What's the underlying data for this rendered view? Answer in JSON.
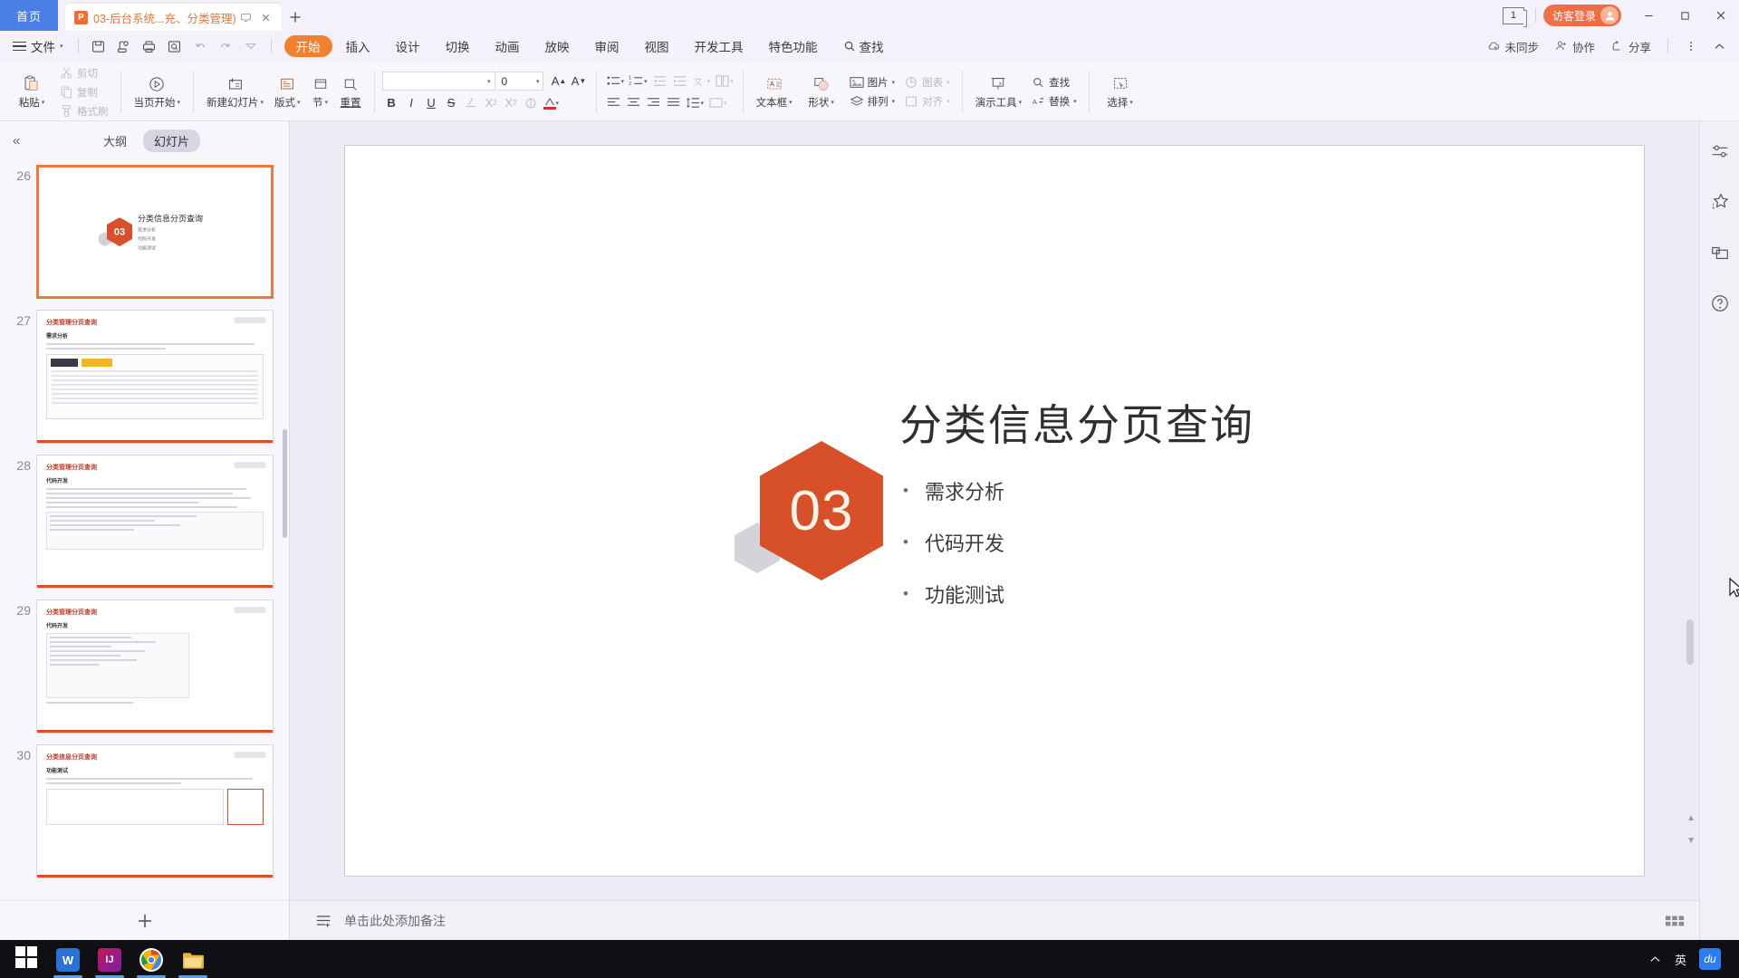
{
  "titlebar": {
    "home_tab": "首页",
    "document_tab": "03-后台系统...充、分类管理)",
    "doc_icon": "powerpoint-icon",
    "restore_tab_icon": "restore-tab-icon",
    "close_tab_icon": "close-tab-icon",
    "new_tab_icon": "new-tab-icon",
    "page_badge": "1",
    "guest_login": "访客登录",
    "avatar_icon": "user-avatar-icon",
    "minimize_icon": "minimize-icon",
    "maximize_icon": "maximize-icon",
    "close_icon": "close-icon"
  },
  "menubar": {
    "file_label": "文件",
    "quick_access": [
      {
        "name": "save-icon",
        "dim": false
      },
      {
        "name": "save-as-cloud-icon",
        "dim": false
      },
      {
        "name": "print-icon",
        "dim": false
      },
      {
        "name": "print-preview-icon",
        "dim": false
      },
      {
        "name": "undo-icon",
        "dim": true
      },
      {
        "name": "redo-icon",
        "dim": true
      },
      {
        "name": "customize-quick-access-icon",
        "dim": false
      }
    ],
    "tabs": [
      {
        "label": "开始",
        "active": true
      },
      {
        "label": "插入",
        "active": false
      },
      {
        "label": "设计",
        "active": false
      },
      {
        "label": "切换",
        "active": false
      },
      {
        "label": "动画",
        "active": false
      },
      {
        "label": "放映",
        "active": false
      },
      {
        "label": "审阅",
        "active": false
      },
      {
        "label": "视图",
        "active": false
      },
      {
        "label": "开发工具",
        "active": false
      },
      {
        "label": "特色功能",
        "active": false
      }
    ],
    "find_tab": "查找",
    "right_items": [
      {
        "label": "未同步",
        "icon": "cloud-sync-icon"
      },
      {
        "label": "协作",
        "icon": "collaborate-icon"
      },
      {
        "label": "分享",
        "icon": "share-icon"
      }
    ],
    "more_icon": "more-options-icon",
    "collapse_ribbon_icon": "collapse-ribbon-icon"
  },
  "toolbar": {
    "paste": "粘贴",
    "cut": "剪切",
    "copy": "复制",
    "format_painter": "格式刷",
    "start_from_page": "当页开始",
    "new_slide": "新建幻灯片",
    "layout": "版式",
    "section": "节",
    "reset": "重置",
    "font_name": "",
    "font_size": "0",
    "bold": "B",
    "italic": "I",
    "underline": "U",
    "strikethrough": "S",
    "text_color_icon": "text-color-icon",
    "clear_format_icon": "clear-format-icon",
    "superscript_icon": "superscript-icon",
    "subscript_icon": "subscript-icon",
    "char_shading_icon": "character-shading-icon",
    "increase_font_icon": "increase-font-size-icon",
    "decrease_font_icon": "decrease-font-size-icon",
    "align_left_icon": "align-left-icon",
    "align_center_icon": "align-center-icon",
    "align_right_icon": "align-right-icon",
    "align_justify_icon": "align-justify-icon",
    "bullet_list_icon": "bullet-list-icon",
    "number_list_icon": "numbered-list-icon",
    "decrease_indent_icon": "decrease-indent-icon",
    "increase_indent_icon": "increase-indent-icon",
    "line_spacing_icon": "line-spacing-icon",
    "columns_icon": "columns-icon",
    "text_direction_icon": "text-direction-icon",
    "textbox": "文本框",
    "shape": "形状",
    "picture": "图片",
    "chart": "图表",
    "arrange": "排列",
    "align_objects": "对齐",
    "present_tools": "演示工具",
    "find": "查找",
    "replace": "替换",
    "select": "选择"
  },
  "slide_panel": {
    "collapse_icon": "collapse-panel-icon",
    "tabs": [
      {
        "label": "大纲",
        "active": false
      },
      {
        "label": "幻灯片",
        "active": true
      }
    ],
    "add_slide_icon": "add-slide-icon",
    "thumbs": [
      {
        "number": "26",
        "selected": true,
        "type": "title",
        "hex_number": "03",
        "title": "分类信息分页查询",
        "bullets": [
          "需求分析",
          "代码开发",
          "功能测试"
        ]
      },
      {
        "number": "27",
        "selected": false,
        "type": "doc-table",
        "title": "分类管理分页查询",
        "subtitle": "需求分析"
      },
      {
        "number": "28",
        "selected": false,
        "type": "doc-code",
        "title": "分类管理分页查询",
        "subtitle": "代码开发"
      },
      {
        "number": "29",
        "selected": false,
        "type": "code-only",
        "title": "分类管理分页查询",
        "subtitle": "代码开发"
      },
      {
        "number": "30",
        "selected": false,
        "type": "doc-test",
        "title": "分类信息分页查询",
        "subtitle": "功能测试"
      }
    ]
  },
  "slide": {
    "hex_number": "03",
    "title": "分类信息分页查询",
    "bullets": [
      "需求分析",
      "代码开发",
      "功能测试"
    ],
    "accent_color": "#d8502a",
    "ghost_color": "#d5d2da"
  },
  "notes": {
    "icon": "notes-icon",
    "placeholder": "单击此处添加备注",
    "right_icon": "notes-options-icon"
  },
  "right_rail": {
    "icons": [
      {
        "name": "properties-sliders-icon"
      },
      {
        "name": "ai-magic-star-icon"
      },
      {
        "name": "slide-frame-icon"
      },
      {
        "name": "help-question-icon"
      }
    ]
  },
  "taskbar": {
    "start_icon": "windows-start-icon",
    "items": [
      {
        "name": "wps-office-icon",
        "label": "W",
        "color": "#2a72d6",
        "active": true
      },
      {
        "name": "intellij-idea-icon",
        "label": "IJ",
        "color": "#9b2e5a",
        "active": true
      },
      {
        "name": "google-chrome-icon",
        "label": "",
        "color": "#ffffff",
        "active": true
      },
      {
        "name": "file-explorer-icon",
        "label": "",
        "color": "#e8b53a",
        "active": true
      }
    ],
    "tray": {
      "chevron_icon": "show-hidden-icons-icon",
      "ime": "英",
      "baidu_icon": "baidu-input-icon",
      "baidu_label": "du"
    }
  }
}
